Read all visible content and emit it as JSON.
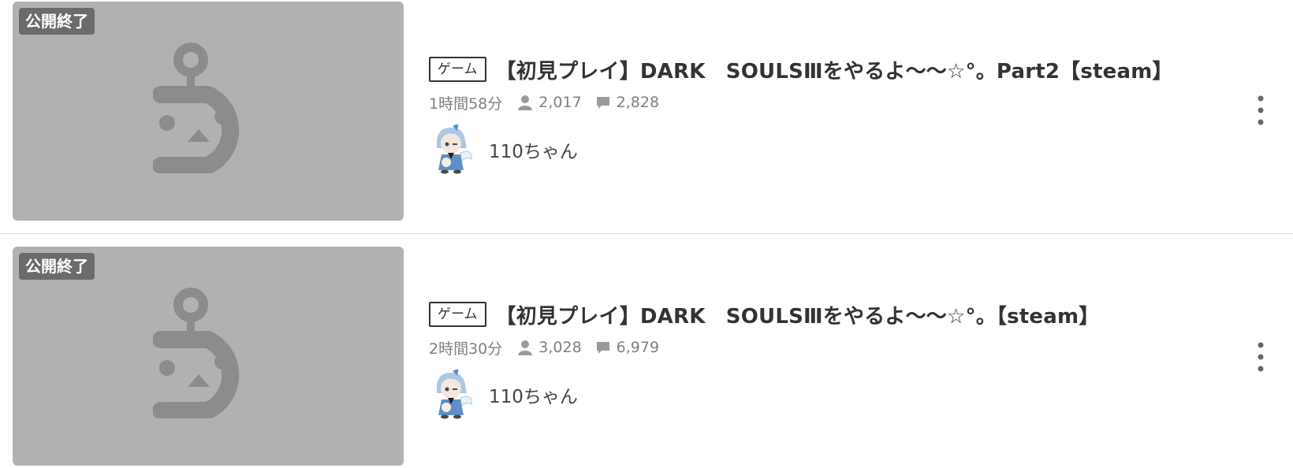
{
  "items": [
    {
      "badge": "公開終了",
      "tag": "ゲーム",
      "title": "【初見プレイ】DARK　SOULSⅢをやるよ〜〜☆°。Part2【steam】",
      "duration": "1時間58分",
      "viewers": "2,017",
      "comments": "2,828",
      "owner": "110ちゃん",
      "icons": {
        "viewers": "person-icon",
        "comments": "comment-icon",
        "more": "more-vertical-icon"
      }
    },
    {
      "badge": "公開終了",
      "tag": "ゲーム",
      "title": "【初見プレイ】DARK　SOULSⅢをやるよ〜〜☆°。【steam】",
      "duration": "2時間30分",
      "viewers": "3,028",
      "comments": "6,979",
      "owner": "110ちゃん",
      "icons": {
        "viewers": "person-icon",
        "comments": "comment-icon",
        "more": "more-vertical-icon"
      }
    }
  ],
  "colors": {
    "thumbnail_bg": "#b1b1b1",
    "placeholder_glyph": "#8c8c8c",
    "badge_bg": "#6b6b6b",
    "text_main": "#333333",
    "text_muted": "#808080",
    "divider": "#dcdcdc"
  }
}
